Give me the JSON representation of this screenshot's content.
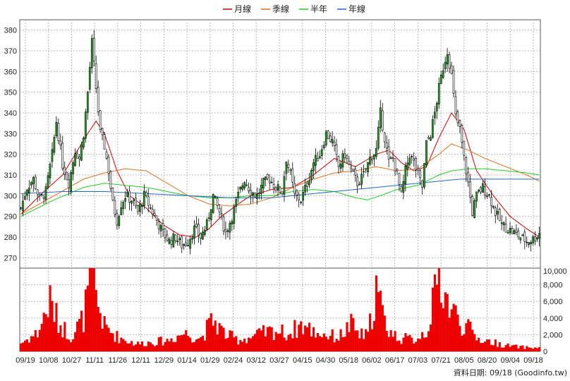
{
  "chart_data": {
    "type": "candlestick",
    "legend": [
      {
        "name": "月線",
        "color": "#cc0000"
      },
      {
        "name": "季線",
        "color": "#e07020"
      },
      {
        "name": "半年",
        "color": "#22cc22"
      },
      {
        "name": "年線",
        "color": "#2266cc"
      }
    ],
    "x_ticks": [
      "09/19",
      "10/08",
      "10/27",
      "11/11",
      "11/26",
      "12/11",
      "12/29",
      "01/14",
      "01/29",
      "02/24",
      "03/12",
      "03/27",
      "04/15",
      "04/30",
      "05/18",
      "06/02",
      "06/17",
      "07/03",
      "07/21",
      "08/05",
      "08/20",
      "09/04",
      "09/18"
    ],
    "price_axis": {
      "ylim": [
        265,
        385
      ],
      "ticks": [
        270,
        280,
        290,
        300,
        310,
        320,
        330,
        340,
        350,
        360,
        370,
        380
      ]
    },
    "volume_axis": {
      "ylim": [
        0,
        10000
      ],
      "tick_labels": [
        "10,000",
        "8,000",
        "6,000",
        "4,000",
        "2,000",
        "0"
      ],
      "tick_values": [
        10000,
        8000,
        6000,
        4000,
        2000,
        0
      ]
    },
    "price_anchors": [
      [
        0,
        294
      ],
      [
        3,
        304
      ],
      [
        6,
        308
      ],
      [
        9,
        298
      ],
      [
        12,
        302
      ],
      [
        15,
        320
      ],
      [
        17,
        336
      ],
      [
        20,
        315
      ],
      [
        23,
        306
      ],
      [
        26,
        322
      ],
      [
        28,
        318
      ],
      [
        30,
        330
      ],
      [
        32,
        350
      ],
      [
        34,
        374
      ],
      [
        36,
        352
      ],
      [
        38,
        330
      ],
      [
        40,
        324
      ],
      [
        42,
        312
      ],
      [
        44,
        296
      ],
      [
        46,
        288
      ],
      [
        48,
        296
      ],
      [
        50,
        300
      ],
      [
        53,
        298
      ],
      [
        56,
        292
      ],
      [
        59,
        300
      ],
      [
        62,
        294
      ],
      [
        65,
        288
      ],
      [
        68,
        282
      ],
      [
        71,
        278
      ],
      [
        74,
        280
      ],
      [
        77,
        276
      ],
      [
        80,
        278
      ],
      [
        83,
        284
      ],
      [
        86,
        280
      ],
      [
        89,
        286
      ],
      [
        92,
        300
      ],
      [
        95,
        292
      ],
      [
        98,
        282
      ],
      [
        101,
        290
      ],
      [
        104,
        300
      ],
      [
        107,
        308
      ],
      [
        110,
        302
      ],
      [
        113,
        300
      ],
      [
        116,
        306
      ],
      [
        119,
        308
      ],
      [
        122,
        304
      ],
      [
        125,
        302
      ],
      [
        127,
        318
      ],
      [
        129,
        310
      ],
      [
        131,
        300
      ],
      [
        134,
        298
      ],
      [
        137,
        306
      ],
      [
        140,
        316
      ],
      [
        143,
        320
      ],
      [
        146,
        330
      ],
      [
        149,
        326
      ],
      [
        152,
        314
      ],
      [
        155,
        320
      ],
      [
        158,
        312
      ],
      [
        161,
        306
      ],
      [
        164,
        310
      ],
      [
        167,
        318
      ],
      [
        170,
        322
      ],
      [
        172,
        340
      ],
      [
        174,
        328
      ],
      [
        176,
        316
      ],
      [
        178,
        318
      ],
      [
        180,
        310
      ],
      [
        182,
        300
      ],
      [
        184,
        312
      ],
      [
        186,
        320
      ],
      [
        188,
        316
      ],
      [
        190,
        310
      ],
      [
        192,
        304
      ],
      [
        194,
        325
      ],
      [
        196,
        330
      ],
      [
        198,
        340
      ],
      [
        200,
        352
      ],
      [
        202,
        362
      ],
      [
        204,
        370
      ],
      [
        206,
        358
      ],
      [
        208,
        338
      ],
      [
        210,
        332
      ],
      [
        212,
        318
      ],
      [
        214,
        306
      ],
      [
        216,
        292
      ],
      [
        218,
        300
      ],
      [
        221,
        304
      ],
      [
        224,
        300
      ],
      [
        227,
        292
      ],
      [
        230,
        286
      ],
      [
        233,
        284
      ],
      [
        236,
        282
      ],
      [
        239,
        280
      ],
      [
        242,
        278
      ],
      [
        245,
        279
      ],
      [
        248,
        282
      ]
    ],
    "volume_anchors": [
      [
        0,
        1000
      ],
      [
        8,
        2200
      ],
      [
        14,
        6000
      ],
      [
        18,
        3500
      ],
      [
        24,
        1800
      ],
      [
        30,
        4000
      ],
      [
        34,
        9800
      ],
      [
        36,
        6500
      ],
      [
        40,
        3000
      ],
      [
        46,
        1800
      ],
      [
        52,
        1200
      ],
      [
        56,
        900
      ],
      [
        62,
        1100
      ],
      [
        70,
        1300
      ],
      [
        78,
        2200
      ],
      [
        86,
        1600
      ],
      [
        92,
        3800
      ],
      [
        98,
        2000
      ],
      [
        104,
        1400
      ],
      [
        110,
        1700
      ],
      [
        116,
        2200
      ],
      [
        122,
        2500
      ],
      [
        128,
        2100
      ],
      [
        134,
        3200
      ],
      [
        140,
        2400
      ],
      [
        146,
        2000
      ],
      [
        152,
        1700
      ],
      [
        158,
        3200
      ],
      [
        162,
        2000
      ],
      [
        166,
        1900
      ],
      [
        170,
        7600
      ],
      [
        174,
        3500
      ],
      [
        178,
        2000
      ],
      [
        182,
        1600
      ],
      [
        188,
        1400
      ],
      [
        194,
        2500
      ],
      [
        198,
        6500
      ],
      [
        200,
        10000
      ],
      [
        204,
        6000
      ],
      [
        206,
        5200
      ],
      [
        210,
        3500
      ],
      [
        214,
        2800
      ],
      [
        218,
        1600
      ],
      [
        224,
        1200
      ],
      [
        232,
        700
      ],
      [
        240,
        500
      ],
      [
        248,
        400
      ]
    ],
    "ma_month": [
      [
        0,
        291
      ],
      [
        10,
        301
      ],
      [
        20,
        310
      ],
      [
        26,
        320
      ],
      [
        32,
        330
      ],
      [
        36,
        336
      ],
      [
        40,
        330
      ],
      [
        46,
        312
      ],
      [
        52,
        300
      ],
      [
        60,
        294
      ],
      [
        68,
        286
      ],
      [
        76,
        281
      ],
      [
        84,
        280
      ],
      [
        90,
        284
      ],
      [
        96,
        290
      ],
      [
        104,
        296
      ],
      [
        110,
        300
      ],
      [
        120,
        303
      ],
      [
        130,
        304
      ],
      [
        140,
        310
      ],
      [
        150,
        318
      ],
      [
        160,
        314
      ],
      [
        170,
        320
      ],
      [
        176,
        322
      ],
      [
        182,
        316
      ],
      [
        188,
        312
      ],
      [
        194,
        314
      ],
      [
        200,
        328
      ],
      [
        206,
        340
      ],
      [
        212,
        332
      ],
      [
        218,
        312
      ],
      [
        226,
        300
      ],
      [
        234,
        290
      ],
      [
        242,
        284
      ],
      [
        248,
        280
      ]
    ],
    "ma_quarter": [
      [
        0,
        291
      ],
      [
        16,
        300
      ],
      [
        30,
        308
      ],
      [
        40,
        311
      ],
      [
        50,
        313
      ],
      [
        60,
        312
      ],
      [
        70,
        306
      ],
      [
        80,
        300
      ],
      [
        90,
        296
      ],
      [
        100,
        295
      ],
      [
        110,
        296
      ],
      [
        120,
        299
      ],
      [
        130,
        304
      ],
      [
        140,
        308
      ],
      [
        150,
        311
      ],
      [
        160,
        312
      ],
      [
        170,
        314
      ],
      [
        180,
        312
      ],
      [
        190,
        313
      ],
      [
        200,
        320
      ],
      [
        206,
        325
      ],
      [
        214,
        322
      ],
      [
        222,
        318
      ],
      [
        232,
        314
      ],
      [
        242,
        310
      ],
      [
        248,
        307
      ]
    ],
    "ma_half": [
      [
        0,
        290
      ],
      [
        16,
        298
      ],
      [
        30,
        304
      ],
      [
        40,
        306
      ],
      [
        50,
        305
      ],
      [
        60,
        304
      ],
      [
        70,
        302
      ],
      [
        80,
        300
      ],
      [
        90,
        299
      ],
      [
        100,
        299
      ],
      [
        110,
        300
      ],
      [
        120,
        300
      ],
      [
        130,
        302
      ],
      [
        140,
        303
      ],
      [
        150,
        302
      ],
      [
        160,
        299
      ],
      [
        166,
        298
      ],
      [
        172,
        300
      ],
      [
        180,
        303
      ],
      [
        190,
        305
      ],
      [
        200,
        310
      ],
      [
        206,
        312
      ],
      [
        214,
        313
      ],
      [
        222,
        313
      ],
      [
        232,
        312
      ],
      [
        242,
        311
      ],
      [
        248,
        310
      ]
    ],
    "ma_year": [
      [
        0,
        301
      ],
      [
        20,
        302
      ],
      [
        40,
        302
      ],
      [
        60,
        301
      ],
      [
        80,
        300
      ],
      [
        100,
        299
      ],
      [
        120,
        299
      ],
      [
        140,
        301
      ],
      [
        160,
        303
      ],
      [
        180,
        305
      ],
      [
        200,
        307
      ],
      [
        210,
        308
      ],
      [
        230,
        308
      ],
      [
        248,
        308
      ]
    ],
    "footer": "資料日期: 09/18  (Goodinfo.tw)"
  }
}
